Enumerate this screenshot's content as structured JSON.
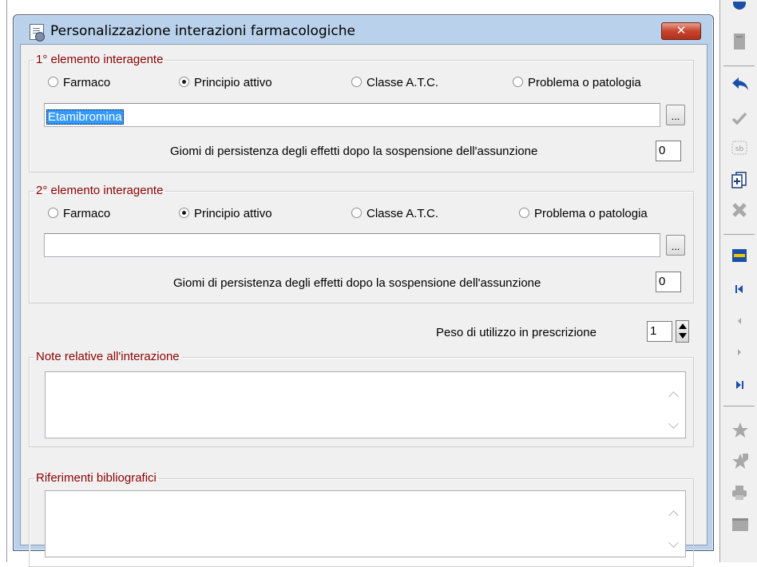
{
  "window": {
    "title": "Personalizzazione interazioni farmacologiche",
    "close_label": "✕"
  },
  "element1": {
    "legend": "1° elemento interagente",
    "options": [
      "Farmaco",
      "Principio attivo",
      "Classe A.T.C.",
      "Problema o patologia"
    ],
    "selected": "Principio attivo",
    "value": "Etamibromina",
    "browse_label": "...",
    "days_label": "Giomi di persistenza degli effetti dopo la sospensione dell'assunzione",
    "days_value": "0"
  },
  "element2": {
    "legend": "2° elemento interagente",
    "options": [
      "Farmaco",
      "Principio attivo",
      "Classe A.T.C.",
      "Problema o patologia"
    ],
    "selected": "Principio attivo",
    "value": "",
    "browse_label": "...",
    "days_label": "Giomi di persistenza degli effetti dopo la sospensione dell'assunzione",
    "days_value": "0"
  },
  "weight": {
    "label": "Peso di utilizzo in prescrizione",
    "value": "1"
  },
  "notes": {
    "legend": "Note relative all'interazione",
    "value": ""
  },
  "references": {
    "legend": "Riferimenti bibliografici",
    "value": ""
  },
  "toolbar_icons": [
    "back-arrow-icon",
    "check-icon",
    "sb-icon",
    "add-record-icon",
    "delete-icon",
    "form-icon",
    "first-record-icon",
    "prev-record-icon",
    "next-record-icon",
    "last-record-icon",
    "star-icon",
    "star-add-icon",
    "print-icon",
    "window-icon"
  ],
  "colors": {
    "legend": "#8b0000",
    "titlebar": "#b9d1ea",
    "selection": "#3399ff",
    "toolbar_blue": "#1a4fa8"
  }
}
